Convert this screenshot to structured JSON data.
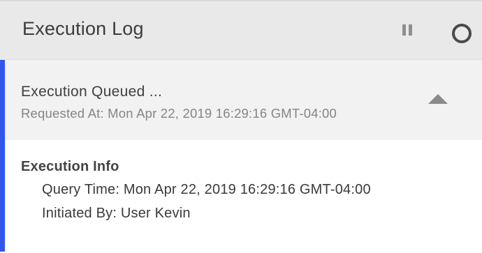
{
  "header": {
    "title": "Execution Log",
    "pause_icon": "pause-icon",
    "refresh_icon": "loading-ring-icon"
  },
  "entry": {
    "title": "Execution Queued ...",
    "subtitle": "Requested At: Mon Apr 22, 2019 16:29:16 GMT-04:00",
    "accent_color": "#3355ee",
    "collapse_icon": "triangle-up-icon"
  },
  "details": {
    "title": "Execution Info",
    "lines": [
      "Query Time: Mon Apr 22, 2019 16:29:16 GMT-04:00",
      "Initiated By: User Kevin"
    ]
  }
}
